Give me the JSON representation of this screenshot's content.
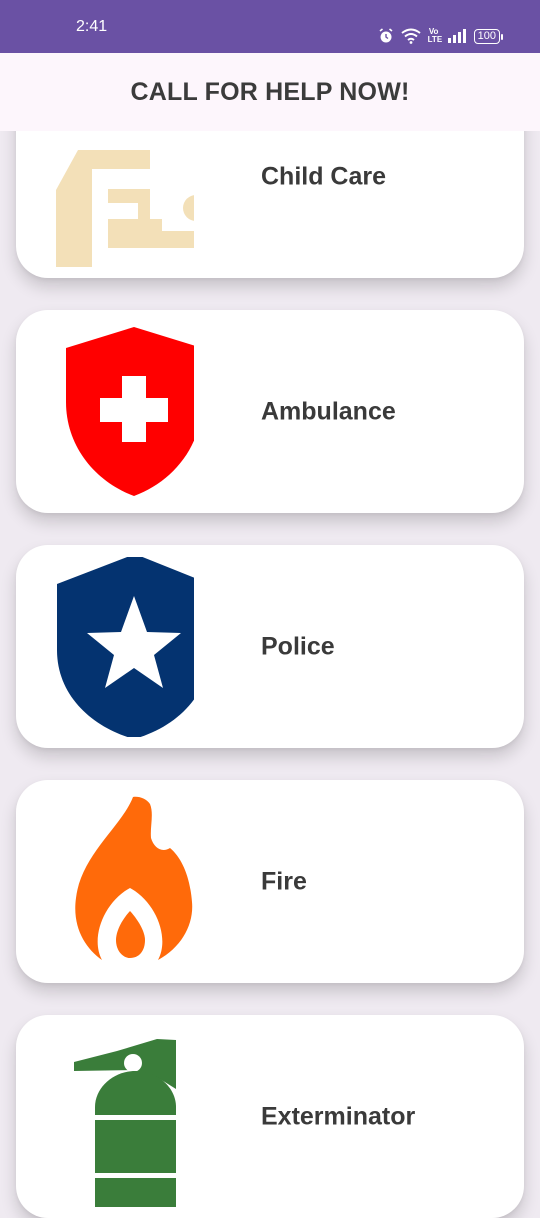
{
  "status_bar": {
    "time": "2:41",
    "volte_top": "Vo",
    "volte_bottom": "LTE",
    "battery": "100",
    "icons": [
      "alarm-icon",
      "wifi-icon",
      "volte-icon",
      "signal-icon",
      "battery-icon"
    ]
  },
  "header": {
    "title": "CALL FOR HELP NOW!"
  },
  "services": [
    {
      "label": "Child Care",
      "icon": "child-care-icon",
      "color": "#f3e0b8"
    },
    {
      "label": "Ambulance",
      "icon": "medical-shield-icon",
      "color": "#ff0000"
    },
    {
      "label": "Police",
      "icon": "police-shield-icon",
      "color": "#043370"
    },
    {
      "label": "Fire",
      "icon": "fire-icon",
      "color": "#ff6a0a"
    },
    {
      "label": "Exterminator",
      "icon": "extinguisher-icon",
      "color": "#3a7d3a"
    }
  ],
  "colors": {
    "status_bar": "#6a51a4",
    "app_bar": "#fdf6fc",
    "background": "#efeaf1",
    "card": "#ffffff"
  }
}
